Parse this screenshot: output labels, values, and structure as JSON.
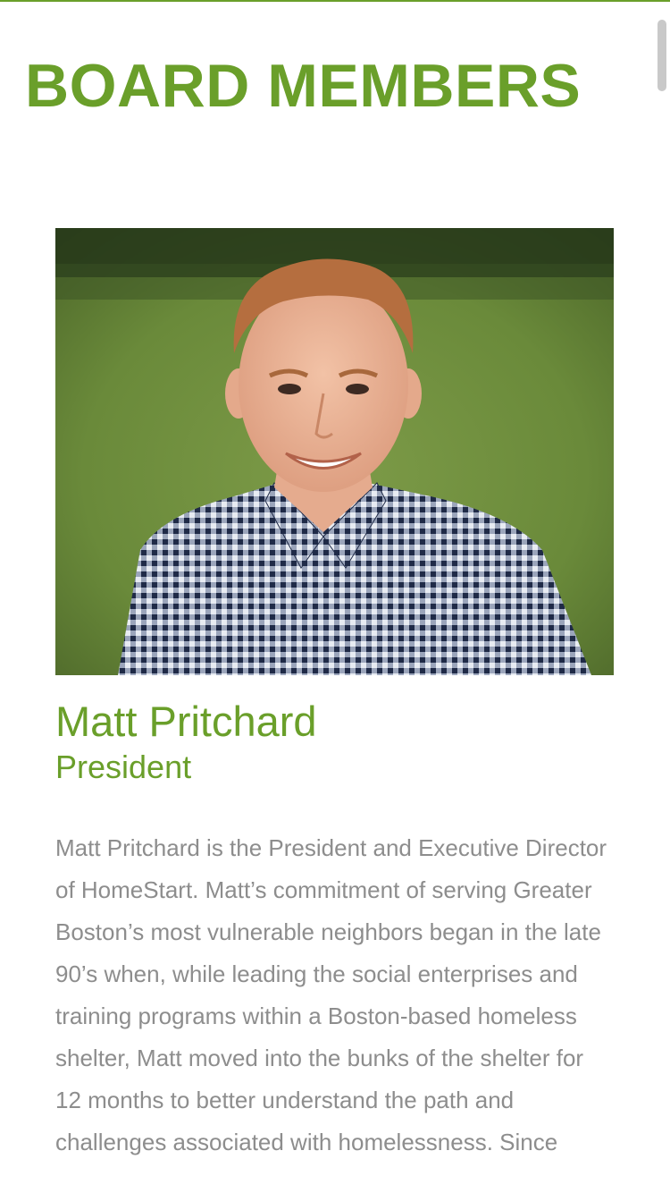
{
  "page": {
    "title": "BOARD MEMBERS",
    "accent_color": "#6a9f2a",
    "text_color": "#8d8d8d"
  },
  "member": {
    "name": "Matt Pritchard",
    "role": "President",
    "photo_icon": "portrait-photo",
    "bio": "Matt Pritchard is the President and Executive Director of HomeStart. Matt’s commitment of serving Greater Boston’s most vulnerable neighbors began in the late 90’s when, while leading the social enterprises and training programs within a Boston-based homeless shelter, Matt moved into the bunks of the shelter for 12 months to better understand the path and challenges associated with homelessness. Since"
  }
}
